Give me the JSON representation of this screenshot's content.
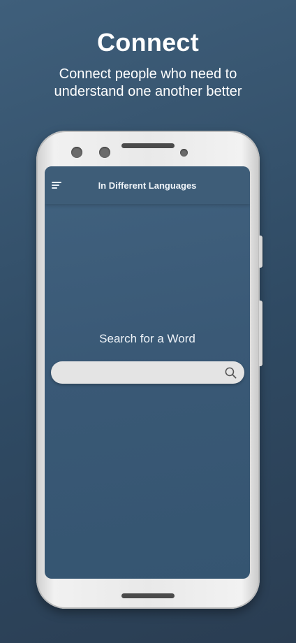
{
  "promo": {
    "title": "Connect",
    "subtitle": "Connect people who need to understand one another better"
  },
  "app": {
    "header": {
      "menu_icon": "menu-icon",
      "title": "In Different Languages"
    },
    "search": {
      "heading": "Search for a Word",
      "value": "",
      "placeholder": "",
      "icon": "search-icon"
    }
  },
  "colors": {
    "background": "#355571",
    "screen": "#3a5976",
    "search_field": "#e4e4e4",
    "text": "#ffffff"
  }
}
